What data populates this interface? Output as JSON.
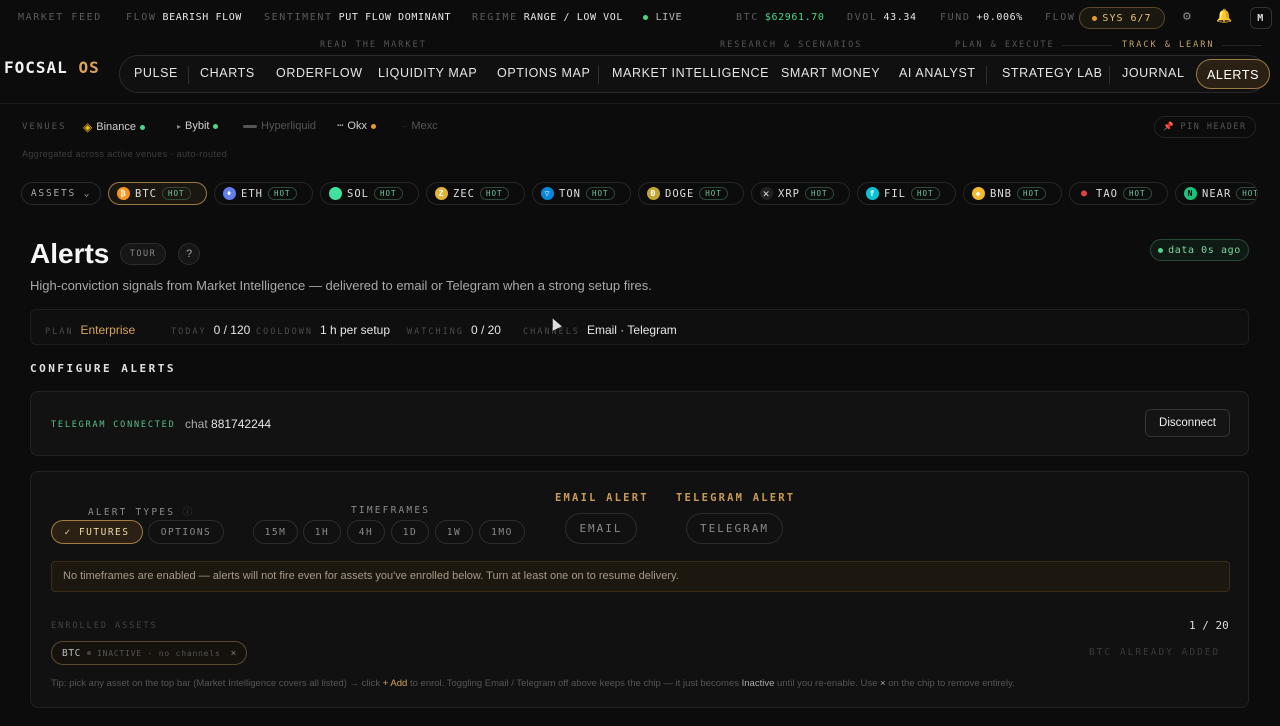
{
  "ticker": {
    "market_feed": "MARKET FEED",
    "flow_k": "FLOW",
    "flow_v": "BEARISH FLOW",
    "sentiment_k": "SENTIMENT",
    "sentiment_v": "PUT FLOW DOMINANT",
    "regime_k": "REGIME",
    "regime_v": "RANGE / LOW VOL",
    "live": "LIVE",
    "btc_k": "BTC",
    "btc_v": "$62961.70",
    "dvol_k": "DVOL",
    "dvol_v": "43.34",
    "fund_k": "FUND",
    "fund_v": "+0.006%",
    "flow2_k": "FLOW",
    "sys": "SYS 6/7",
    "avatar": "M"
  },
  "groups": {
    "read": "READ THE MARKET",
    "research": "RESEARCH & SCENARIOS",
    "plan": "PLAN & EXECUTE",
    "track": "TRACK & LEARN"
  },
  "brand": {
    "name": "FOCSAL",
    "os": "OS"
  },
  "nav": [
    "PULSE",
    "CHARTS",
    "ORDERFLOW",
    "LIQUIDITY MAP",
    "OPTIONS MAP",
    "MARKET INTELLIGENCE",
    "SMART MONEY",
    "AI ANALYST",
    "STRATEGY LAB",
    "JOURNAL",
    "ALERTS"
  ],
  "venues": {
    "label": "VENUES",
    "items": [
      "Binance",
      "Bybit",
      "Hyperliquid",
      "Okx",
      "Mexc"
    ],
    "note": "Aggregated across active venues · auto-routed",
    "pin": "PIN HEADER"
  },
  "assets": {
    "label": "ASSETS",
    "hot": "HOT",
    "items": [
      "BTC",
      "ETH",
      "SOL",
      "ZEC",
      "TON",
      "DOGE",
      "XRP",
      "FIL",
      "BNB",
      "TAO",
      "NEAR"
    ]
  },
  "page": {
    "title": "Alerts",
    "tour": "TOUR",
    "help": "?",
    "fresh": "data 0s ago",
    "subtitle": "High-conviction signals from Market Intelligence — delivered to email or Telegram when a strong setup fires."
  },
  "stats": {
    "plan_k": "PLAN",
    "plan_v": "Enterprise",
    "today_k": "TODAY",
    "today_v": "0 / 120",
    "cooldown_k": "COOLDOWN",
    "cooldown_v": "1 h per setup",
    "watching_k": "WATCHING",
    "watching_v": "0 / 20",
    "channels_k": "CHANNELS",
    "channels_v": "Email · Telegram"
  },
  "configure": {
    "heading": "CONFIGURE ALERTS",
    "tg_label": "TELEGRAM CONNECTED",
    "tg_chat_k": "chat",
    "tg_chat_v": "881742244",
    "disconnect": "Disconnect",
    "alert_types": "ALERT TYPES",
    "futures": "✓ FUTURES",
    "options": "OPTIONS",
    "timeframes_label": "TIMEFRAMES",
    "timeframes": [
      "15M",
      "1H",
      "4H",
      "1D",
      "1W",
      "1MO"
    ],
    "email_alert": "EMAIL ALERT",
    "email_btn": "EMAIL",
    "telegram_alert": "TELEGRAM ALERT",
    "telegram_btn": "TELEGRAM",
    "warning": "No timeframes are enabled — alerts will not fire even for assets you've enrolled below. Turn at least one on to resume delivery.",
    "enrolled_label": "ENROLLED ASSETS",
    "enrolled_count": "1 / 20",
    "chip_asset": "BTC",
    "chip_status": "INACTIVE · no channels",
    "chip_remove": "×",
    "already_added": "BTC ALREADY ADDED",
    "tip_a": "Tip: pick any asset on the top bar (Market Intelligence covers all listed) → click ",
    "tip_add": "+ Add",
    "tip_b": " to enrol. Toggling Email / Telegram off above keeps the chip — it just becomes ",
    "tip_inactive": "Inactive",
    "tip_c": " until you re-enable. Use ",
    "tip_x": "×",
    "tip_d": " on the chip to remove entirely."
  },
  "colors": {
    "accent": "#d9a45a",
    "green": "#4ad68a",
    "bg": "#0c0c0d"
  }
}
